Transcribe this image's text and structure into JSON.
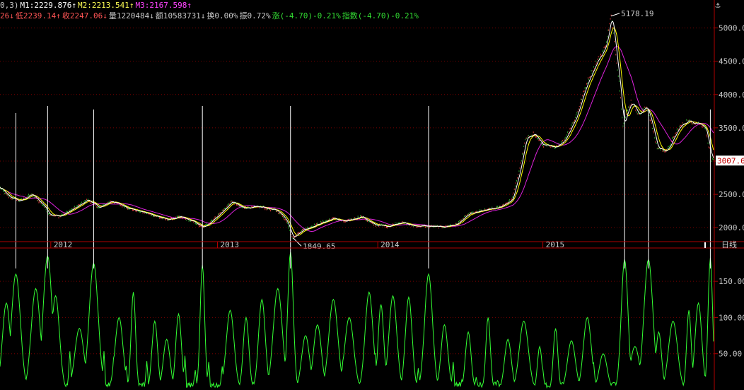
{
  "header": {
    "row1": [
      {
        "text": "0,3)",
        "color": "#c8c8c8"
      },
      {
        "text": "M1:2229.876↑",
        "color": "#ffffff"
      },
      {
        "text": "M2:2213.541↑",
        "color": "#ffff55"
      },
      {
        "text": "M3:2167.598↑",
        "color": "#ff44ff"
      }
    ],
    "row2": [
      {
        "text": "26↓",
        "color": "#ff5555"
      },
      {
        "text": "低2239.14↑",
        "color": "#ff5555"
      },
      {
        "text": "收2247.06↓",
        "color": "#ff5555"
      },
      {
        "text": "量1220484↓",
        "color": "#c8c8c8"
      },
      {
        "text": "额10583731↓",
        "color": "#c8c8c8"
      },
      {
        "text": "换0.00%",
        "color": "#c8c8c8"
      },
      {
        "text": "振0.72%",
        "color": "#c8c8c8"
      },
      {
        "text": "涨(-4.70)-0.21%",
        "color": "#33dd33"
      },
      {
        "text": "指数(-4.70)-0.21%",
        "color": "#33dd33"
      }
    ]
  },
  "icons": {
    "top_right": "anchor-icon"
  },
  "colors": {
    "background": "#000000",
    "axis_red": "#b00000",
    "grid_dotted": "#7a0000",
    "price_white": "#ffffff",
    "price_yellow": "#ffff00",
    "price_green": "#33cc33",
    "price_magenta": "#dd22dd",
    "indicator_green": "#33ff33",
    "label_text": "#c8c8c8",
    "price_tag_bg": "#ffffff",
    "price_tag_text": "#c00000"
  },
  "chart_data": [
    {
      "type": "line",
      "ylim": [
        1790,
        5420
      ],
      "y_ticks": [
        "5000.00",
        "4500.00",
        "4000.00",
        "3500.00",
        "3000.00",
        "2500.00",
        "2000.00"
      ],
      "y_tick_values": [
        5000,
        4500,
        4000,
        3500,
        3000,
        2500,
        2000
      ],
      "x_labels": [
        "2012",
        "2013",
        "2014",
        "2015"
      ],
      "x_label_index": [
        64,
        274,
        476,
        684
      ],
      "period_label": "日线",
      "current_price_tag": "3007.6",
      "current_price": 3007.6,
      "annotations": [
        {
          "text": "5178.19",
          "index": 770,
          "value": 5178.19,
          "position": "right"
        },
        {
          "text": "1849.65",
          "index": 369,
          "value": 1849.65,
          "position": "right-below"
        }
      ],
      "signal_indices": [
        20,
        60,
        118,
        255,
        366,
        540,
        787,
        817,
        895
      ],
      "anchors": [
        [
          0,
          2600
        ],
        [
          10,
          2470
        ],
        [
          25,
          2400
        ],
        [
          40,
          2500
        ],
        [
          55,
          2330
        ],
        [
          62,
          2200
        ],
        [
          75,
          2170
        ],
        [
          95,
          2300
        ],
        [
          110,
          2420
        ],
        [
          125,
          2300
        ],
        [
          140,
          2400
        ],
        [
          165,
          2280
        ],
        [
          190,
          2200
        ],
        [
          210,
          2120
        ],
        [
          228,
          2160
        ],
        [
          245,
          2080
        ],
        [
          256,
          2000
        ],
        [
          275,
          2190
        ],
        [
          292,
          2390
        ],
        [
          305,
          2300
        ],
        [
          330,
          2310
        ],
        [
          350,
          2250
        ],
        [
          360,
          2120
        ],
        [
          369,
          1849.65
        ],
        [
          380,
          1960
        ],
        [
          400,
          2050
        ],
        [
          420,
          2140
        ],
        [
          435,
          2090
        ],
        [
          455,
          2170
        ],
        [
          470,
          2050
        ],
        [
          488,
          2020
        ],
        [
          505,
          2080
        ],
        [
          520,
          2030
        ],
        [
          540,
          2020
        ],
        [
          558,
          2010
        ],
        [
          575,
          2050
        ],
        [
          590,
          2200
        ],
        [
          610,
          2260
        ],
        [
          628,
          2300
        ],
        [
          645,
          2420
        ],
        [
          655,
          2900
        ],
        [
          662,
          3320
        ],
        [
          672,
          3420
        ],
        [
          683,
          3250
        ],
        [
          697,
          3200
        ],
        [
          710,
          3300
        ],
        [
          725,
          3650
        ],
        [
          740,
          4200
        ],
        [
          752,
          4500
        ],
        [
          762,
          4700
        ],
        [
          770,
          5178.19
        ],
        [
          775,
          4700
        ],
        [
          780,
          4200
        ],
        [
          785,
          3550
        ],
        [
          795,
          3900
        ],
        [
          805,
          3700
        ],
        [
          815,
          3820
        ],
        [
          820,
          3600
        ],
        [
          828,
          3200
        ],
        [
          840,
          3150
        ],
        [
          855,
          3500
        ],
        [
          865,
          3600
        ],
        [
          878,
          3580
        ],
        [
          888,
          3520
        ],
        [
          897,
          3007.6
        ]
      ]
    },
    {
      "type": "line",
      "ylim": [
        0,
        195
      ],
      "y_ticks": [
        "150.00",
        "100.00",
        "50.00"
      ],
      "y_tick_values": [
        150,
        100,
        50
      ],
      "peaks": [
        [
          20,
          160
        ],
        [
          60,
          185
        ],
        [
          118,
          175
        ],
        [
          255,
          172
        ],
        [
          366,
          190
        ],
        [
          540,
          160
        ],
        [
          787,
          180
        ],
        [
          817,
          180
        ],
        [
          895,
          182
        ],
        [
          8,
          120
        ],
        [
          45,
          140
        ],
        [
          70,
          130
        ],
        [
          100,
          85
        ],
        [
          150,
          100
        ],
        [
          168,
          135
        ],
        [
          195,
          95
        ],
        [
          210,
          70
        ],
        [
          225,
          105
        ],
        [
          290,
          110
        ],
        [
          310,
          100
        ],
        [
          330,
          125
        ],
        [
          350,
          140
        ],
        [
          385,
          75
        ],
        [
          400,
          90
        ],
        [
          420,
          125
        ],
        [
          440,
          100
        ],
        [
          465,
          135
        ],
        [
          480,
          118
        ],
        [
          495,
          130
        ],
        [
          515,
          128
        ],
        [
          560,
          90
        ],
        [
          590,
          80
        ],
        [
          615,
          100
        ],
        [
          640,
          70
        ],
        [
          660,
          95
        ],
        [
          680,
          60
        ],
        [
          700,
          85
        ],
        [
          720,
          68
        ],
        [
          740,
          100
        ],
        [
          760,
          50
        ],
        [
          800,
          60
        ],
        [
          830,
          80
        ],
        [
          848,
          95
        ],
        [
          868,
          110
        ],
        [
          880,
          120
        ]
      ]
    }
  ]
}
